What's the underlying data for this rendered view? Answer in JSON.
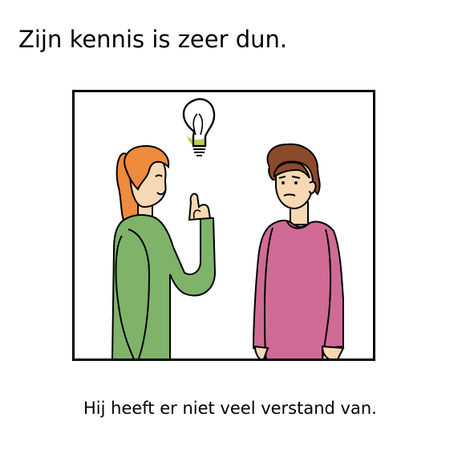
{
  "title": "Zijn kennis is zeer dun.",
  "caption": "Hij heeft er niet veel verstand van.",
  "colors": {
    "frame": "#000000",
    "bulb_glow": "#b7cf55",
    "left_person_hair": "#f08a3c",
    "left_person_shirt": "#7fb36a",
    "right_person_hair": "#8b4a2b",
    "right_person_shirt": "#cf6b96",
    "skin": "#f7d8b5"
  }
}
